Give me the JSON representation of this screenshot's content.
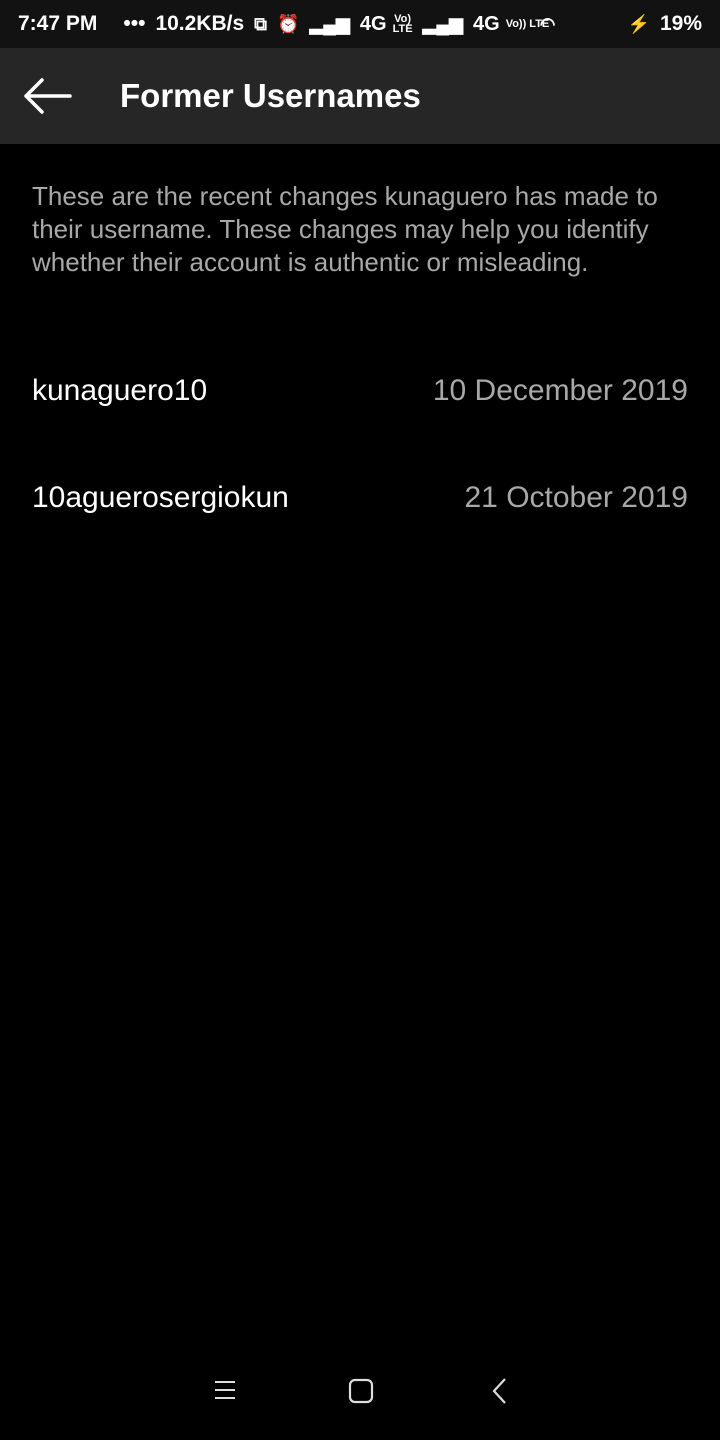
{
  "status_bar": {
    "time": "7:47 PM",
    "dots": "•••",
    "speed": "10.2KB/s",
    "net1": "4G",
    "volte": "Vo)) LTE",
    "net2": "4G",
    "battery": "19%"
  },
  "header": {
    "title": "Former Usernames",
    "back_icon": "arrow-left-icon"
  },
  "description": "These are the recent changes kunaguero has made to their username. These changes may help you identify whether their account is authentic or misleading.",
  "usernames": [
    {
      "username": "kunaguero10",
      "date": "10 December 2019"
    },
    {
      "username": "10aguerosergiokun",
      "date": "21 October 2019"
    }
  ],
  "nav_bar": {
    "icons": [
      "menu-icon",
      "home-icon",
      "back-icon"
    ]
  }
}
